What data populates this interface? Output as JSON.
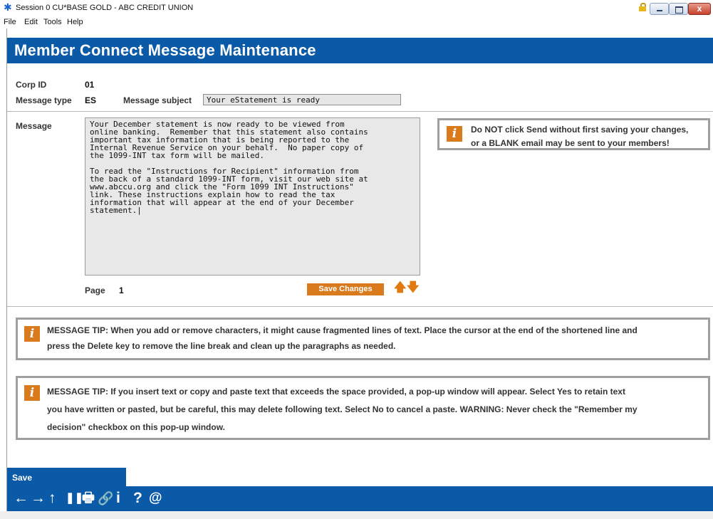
{
  "window": {
    "title": "Session 0 CU*BASE GOLD - ABC CREDIT UNION",
    "icon": "asterisk-app-icon",
    "close_glyph": "x"
  },
  "menu": [
    "File",
    "Edit",
    "Tools",
    "Help"
  ],
  "header": {
    "title": "Member Connect Message Maintenance"
  },
  "fields": {
    "corp_id_label": "Corp ID",
    "corp_id_value": "01",
    "message_type_label": "Message type",
    "message_type_value": "ES",
    "subject_label": "Message subject",
    "subject_value": "Your eStatement is ready",
    "message_label": "Message",
    "message_text": "Your December statement is now ready to be viewed from\nonline banking.  Remember that this statement also contains\nimportant tax information that is being reported to the\nInternal Revenue Service on your behalf.  No paper copy of\nthe 1099-INT tax form will be mailed.\n\nTo read the \"Instructions for Recipient\" information from\nthe back of a standard 1099-INT form, visit our web site at\nwww.abccu.org and click the \"Form 1099 INT Instructions\"\nlink. These instructions explain how to read the tax\ninformation that will appear at the end of your December\nstatement.|",
    "page_label": "Page",
    "page_value": "1"
  },
  "buttons": {
    "save_changes": "Save Changes",
    "up_arrow": "🡅",
    "down_arrow": "🡇"
  },
  "warning": {
    "line1": "Do NOT click Send without first saving your changes,",
    "line2": "or a BLANK email may be sent to your members!"
  },
  "tips": [
    {
      "line1": "MESSAGE TIP:  When you add or remove characters, it might cause fragmented lines of text.  Place the cursor at the end of the shortened line and",
      "line2": "press the Delete key to remove the line break and clean up the paragraphs as needed."
    },
    {
      "line1": "MESSAGE TIP:  If you insert text or copy and paste text that exceeds the space provided, a pop-up window will appear. Select Yes to retain text",
      "line2": "you have written or pasted, but be careful, this may delete following text. Select No to cancel a paste.  WARNING:  Never check the \"Remember my",
      "line3": "decision\" checkbox on this pop-up window."
    }
  ],
  "info_glyph": "i",
  "bottom": {
    "save_label": "Save",
    "toolbar": [
      "←",
      "→",
      "↑",
      "❚❚",
      "🖶",
      "🔗",
      "i",
      "?",
      "@"
    ]
  },
  "colors": {
    "header_blue": "#0b5aa8",
    "accent_orange": "#d97a1c"
  }
}
